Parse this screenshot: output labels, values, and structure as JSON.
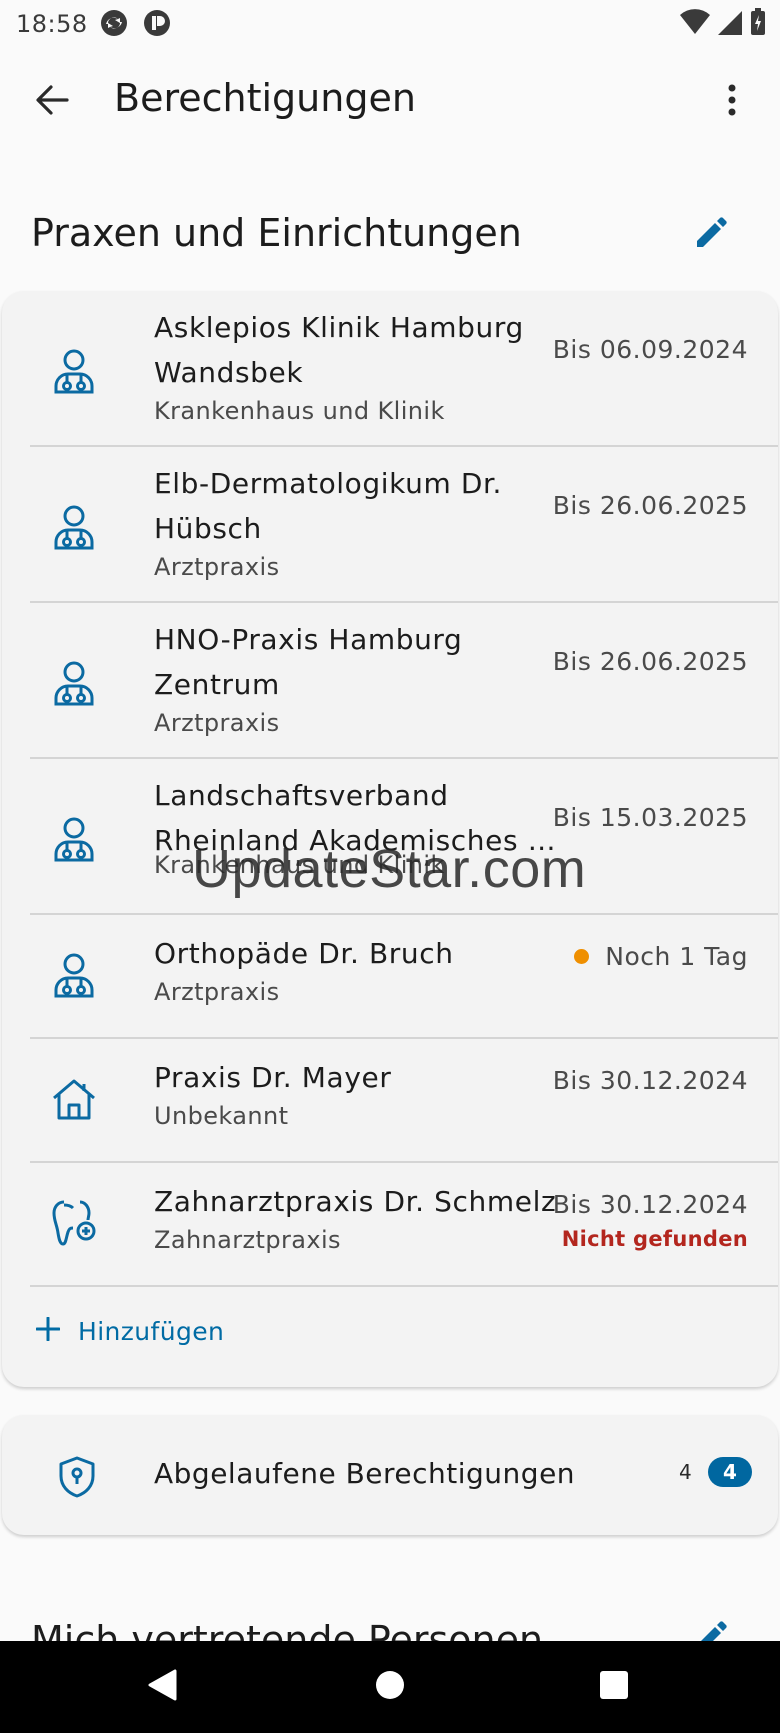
{
  "status_bar": {
    "time": "18:58",
    "icons": [
      "sync-icon",
      "app-notification-icon",
      "wifi-icon",
      "signal-icon",
      "battery-icon"
    ]
  },
  "app_bar": {
    "title": "Berechtigungen",
    "back_icon": "arrow-back-icon",
    "more_icon": "more-vert-icon"
  },
  "sections": {
    "practices": {
      "title": "Praxen und Einrichtungen",
      "edit_icon": "pencil-icon"
    },
    "representatives": {
      "title": "Mich vertretende Personen",
      "edit_icon": "pencil-icon"
    }
  },
  "practices": [
    {
      "icon": "doctor-icon",
      "name": "Asklepios Klinik Hamburg Wandsbek",
      "type": "Krankenhaus und Klinik",
      "date": "Bis 06.09.2024"
    },
    {
      "icon": "doctor-icon",
      "name": "Elb-Dermatologikum Dr. Hübsch",
      "type": "Arztpraxis",
      "date": "Bis 26.06.2025"
    },
    {
      "icon": "doctor-icon",
      "name": "HNO-Praxis Hamburg Zentrum",
      "type": "Arztpraxis",
      "date": "Bis 26.06.2025"
    },
    {
      "icon": "doctor-icon",
      "name": "Landschaftsverband",
      "name_line2": "Rheinland Akademisches …",
      "type": "Krankenhaus und Klinik",
      "date": "Bis 15.03.2025"
    },
    {
      "icon": "doctor-icon",
      "name": "Orthopäde Dr. Bruch",
      "type": "Arztpraxis",
      "date": "Noch 1 Tag",
      "status_dot_color": "#ef8f00"
    },
    {
      "icon": "house-icon",
      "name": "Praxis Dr. Mayer",
      "type": "Unbekannt",
      "date": "Bis 30.12.2024"
    },
    {
      "icon": "tooth-icon",
      "name": "Zahnarztpraxis Dr. Schmelz",
      "type": "Zahnarztpraxis",
      "date": "Bis 30.12.2024",
      "warning": "Nicht gefunden"
    }
  ],
  "add_button": {
    "label": "Hinzufügen",
    "icon": "plus-icon"
  },
  "expired": {
    "label": "Abgelaufene Berechtigungen",
    "count": "4",
    "badge": "4",
    "icon": "shield-keyhole-icon"
  },
  "watermark": "UpdateStar.com",
  "nav_bar": {
    "icons": [
      "back-triangle-icon",
      "home-circle-icon",
      "recents-square-icon"
    ]
  },
  "colors": {
    "accent": "#006ba4",
    "warning": "#b3261e",
    "status_dot": "#ef8f00",
    "badge": "#0067a0"
  }
}
